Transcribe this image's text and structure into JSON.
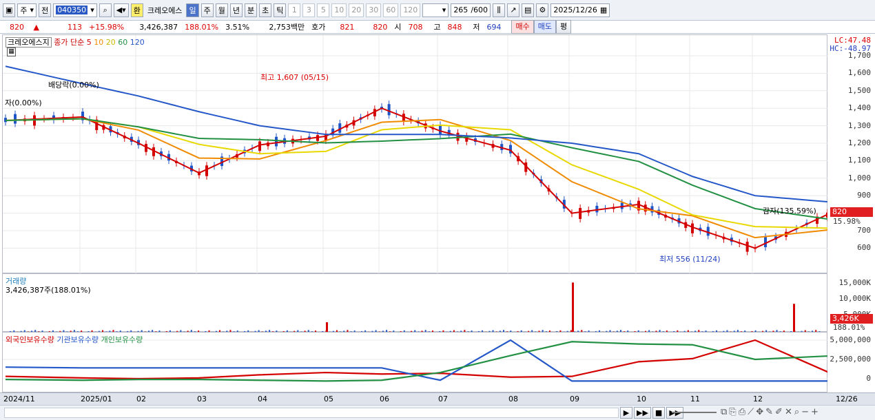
{
  "toolbar": {
    "market": "주",
    "prev": "전",
    "code": "040350",
    "exchange_icon": "환",
    "name": "크레오에스",
    "periods": [
      "일",
      "주",
      "월",
      "년",
      "분",
      "초",
      "틱"
    ],
    "active_period": "일",
    "intervals": [
      "1",
      "3",
      "5",
      "10",
      "20",
      "30",
      "60",
      "120"
    ],
    "count": "265",
    "total": "/600",
    "date": "2025/12/26"
  },
  "quote": {
    "price": "820",
    "arrow": "▲",
    "change": "113",
    "pct": "+15.98%",
    "volume": "3,426,387",
    "vol_pct": "188.01%",
    "turnover": "3.51%",
    "amount": "2,753백만",
    "hoga_label": "호가",
    "ask": "821",
    "bid": "820",
    "open_label": "시",
    "open": "708",
    "high_label": "고",
    "high": "848",
    "low_label": "저",
    "low": "694",
    "buy": "매수",
    "sell": "매도",
    "avg": "평"
  },
  "main": {
    "title": "크레오에스지",
    "ma_legend": "종가 단순",
    "ma": [
      "5",
      "10",
      "20",
      "60",
      "120"
    ],
    "ma_colors": [
      "#d40000",
      "#f08a00",
      "#e8d800",
      "#229043",
      "#2457c8"
    ],
    "yticks": [
      "1,700",
      "1,600",
      "1,500",
      "1,400",
      "1,300",
      "1,200",
      "1,100",
      "1,000",
      "900",
      "800",
      "700",
      "600"
    ],
    "lc": "LC:47.48",
    "hc": "HC:-48.97",
    "cur_price": "820",
    "cur_pct": "15.98%",
    "annotations": {
      "dividend": "배당락(0.00%)",
      "right": "자(0.00%)",
      "high": "최고 1,607 (05/15)",
      "low": "최저 556 (11/24)",
      "reduction": "감자(135.59%)"
    }
  },
  "volume": {
    "title": "거래량",
    "value": "3,426,387주(188.01%)",
    "yticks": [
      "15,000K",
      "10,000K",
      "5,000K"
    ],
    "cur": "3,426K",
    "cur_pct": "188.01%"
  },
  "holdings": {
    "labels": [
      "외국인보유수량",
      "기관보유수량",
      "개인보유수량"
    ],
    "colors": [
      "#d40000",
      "#2457c8",
      "#229043"
    ],
    "yticks": [
      "5,000,000",
      "2,500,000",
      "0"
    ]
  },
  "xaxis": [
    "2024/11",
    "2025/01",
    "02",
    "03",
    "04",
    "05",
    "06",
    "07",
    "08",
    "09",
    "10",
    "11",
    "12",
    "12/26"
  ],
  "chart_data": {
    "type": "line",
    "title": "크레오에스지",
    "x": [
      "2024/11",
      "2025/01",
      "02",
      "03",
      "04",
      "05",
      "06",
      "07",
      "08",
      "09",
      "10",
      "11",
      "12",
      "12/26"
    ],
    "series": [
      {
        "name": "종가",
        "values": [
          1330,
          1350,
          1200,
          1030,
          1190,
          1240,
          1400,
          1270,
          1160,
          800,
          850,
          720,
          600,
          820
        ]
      },
      {
        "name": "120",
        "values": [
          1640,
          1540,
          1470,
          1380,
          1300,
          1250,
          1250,
          1250,
          1230,
          1200,
          1140,
          1010,
          900,
          860
        ]
      }
    ],
    "ylim": [
      560,
      1720
    ],
    "volume_spikes_K": [
      {
        "x": "05",
        "v": 3200
      },
      {
        "x": "09",
        "v": 15500
      },
      {
        "x": "12",
        "v": 8900
      },
      {
        "x": "12/26",
        "v": 3426
      }
    ]
  }
}
